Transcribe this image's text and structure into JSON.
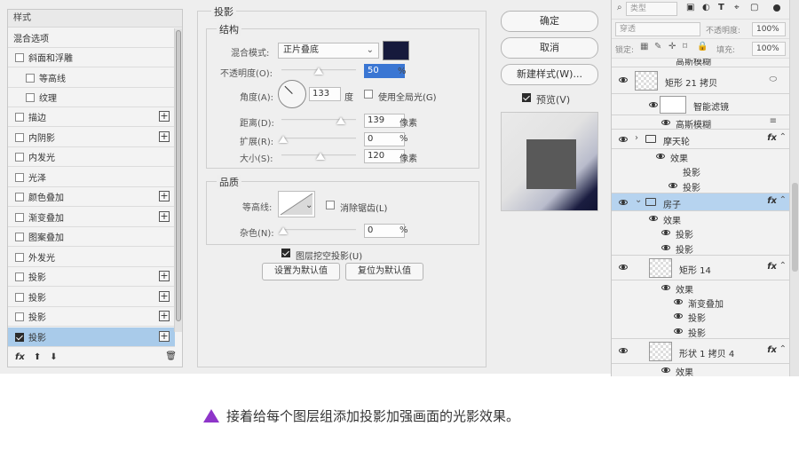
{
  "dialog": {
    "styles_panel": {
      "header": "样式",
      "items": [
        {
          "label": "混合选项",
          "checkbox": false,
          "checked": false,
          "plus": false
        },
        {
          "label": "斜面和浮雕",
          "checkbox": true,
          "checked": false,
          "plus": false
        },
        {
          "label": "等高线",
          "checkbox": true,
          "checked": false,
          "plus": false,
          "indent": true
        },
        {
          "label": "纹理",
          "checkbox": true,
          "checked": false,
          "plus": false,
          "indent": true
        },
        {
          "label": "描边",
          "checkbox": true,
          "checked": false,
          "plus": true
        },
        {
          "label": "内阴影",
          "checkbox": true,
          "checked": false,
          "plus": true
        },
        {
          "label": "内发光",
          "checkbox": true,
          "checked": false,
          "plus": false
        },
        {
          "label": "光泽",
          "checkbox": true,
          "checked": false,
          "plus": false
        },
        {
          "label": "颜色叠加",
          "checkbox": true,
          "checked": false,
          "plus": true
        },
        {
          "label": "渐变叠加",
          "checkbox": true,
          "checked": false,
          "plus": true
        },
        {
          "label": "图案叠加",
          "checkbox": true,
          "checked": false,
          "plus": false
        },
        {
          "label": "外发光",
          "checkbox": true,
          "checked": false,
          "plus": false
        },
        {
          "label": "投影",
          "checkbox": true,
          "checked": false,
          "plus": true
        },
        {
          "label": "投影",
          "checkbox": true,
          "checked": false,
          "plus": true
        },
        {
          "label": "投影",
          "checkbox": true,
          "checked": false,
          "plus": true
        },
        {
          "label": "投影",
          "checkbox": true,
          "checked": true,
          "plus": true,
          "selected": true
        }
      ],
      "footer_fx": "fx"
    },
    "drop_shadow": {
      "title": "投影",
      "structure_title": "结构",
      "blend_mode_label": "混合模式:",
      "blend_mode_value": "正片叠底",
      "blend_color": "#161a3c",
      "opacity_label": "不透明度(O):",
      "opacity_value": "50",
      "opacity_unit": "%",
      "angle_label": "角度(A):",
      "angle_value": "133",
      "angle_unit": "度",
      "global_light_label": "使用全局光(G)",
      "distance_label": "距离(D):",
      "distance_value": "139",
      "distance_unit": "像素",
      "spread_label": "扩展(R):",
      "spread_value": "0",
      "spread_unit": "%",
      "size_label": "大小(S):",
      "size_value": "120",
      "size_unit": "像素",
      "quality_title": "品质",
      "contour_label": "等高线:",
      "antialias_label": "消除锯齿(L)",
      "noise_label": "杂色(N):",
      "noise_value": "0",
      "noise_unit": "%",
      "knockout_label": "图层挖空投影(U)",
      "make_default": "设置为默认值",
      "reset_default": "复位为默认值"
    },
    "buttons": {
      "ok": "确定",
      "cancel": "取消",
      "new_style": "新建样式(W)...",
      "preview": "预览(V)"
    }
  },
  "layers_panel": {
    "filter_kind": "类型",
    "blend_mode": "穿透",
    "opacity_label": "不透明度:",
    "opacity_value": "100%",
    "lock_label": "锁定:",
    "fill_label": "填充:",
    "fill_value": "100%",
    "rows": {
      "top_partial": "高斯模糊",
      "rect21": "矩形 21 拷贝",
      "smart_filter": "智能滤镜",
      "gaussian": "高斯模糊",
      "ferris": "摩天轮",
      "ferris_effects": "效果",
      "ferris_shadow1": "投影",
      "ferris_shadow2": "投影",
      "house": "房子",
      "house_effects": "效果",
      "house_shadow1": "投影",
      "house_shadow2": "投影",
      "rect14": "矩形 14",
      "rect14_effects": "效果",
      "rect14_gradient": "渐变叠加",
      "rect14_shadow1": "投影",
      "rect14_shadow2": "投影",
      "shape": "形状 1 拷贝 4",
      "shape_effects": "效果"
    },
    "fx": "fx"
  },
  "caption": "接着给每个图层组添加投影加强画面的光影效果。"
}
